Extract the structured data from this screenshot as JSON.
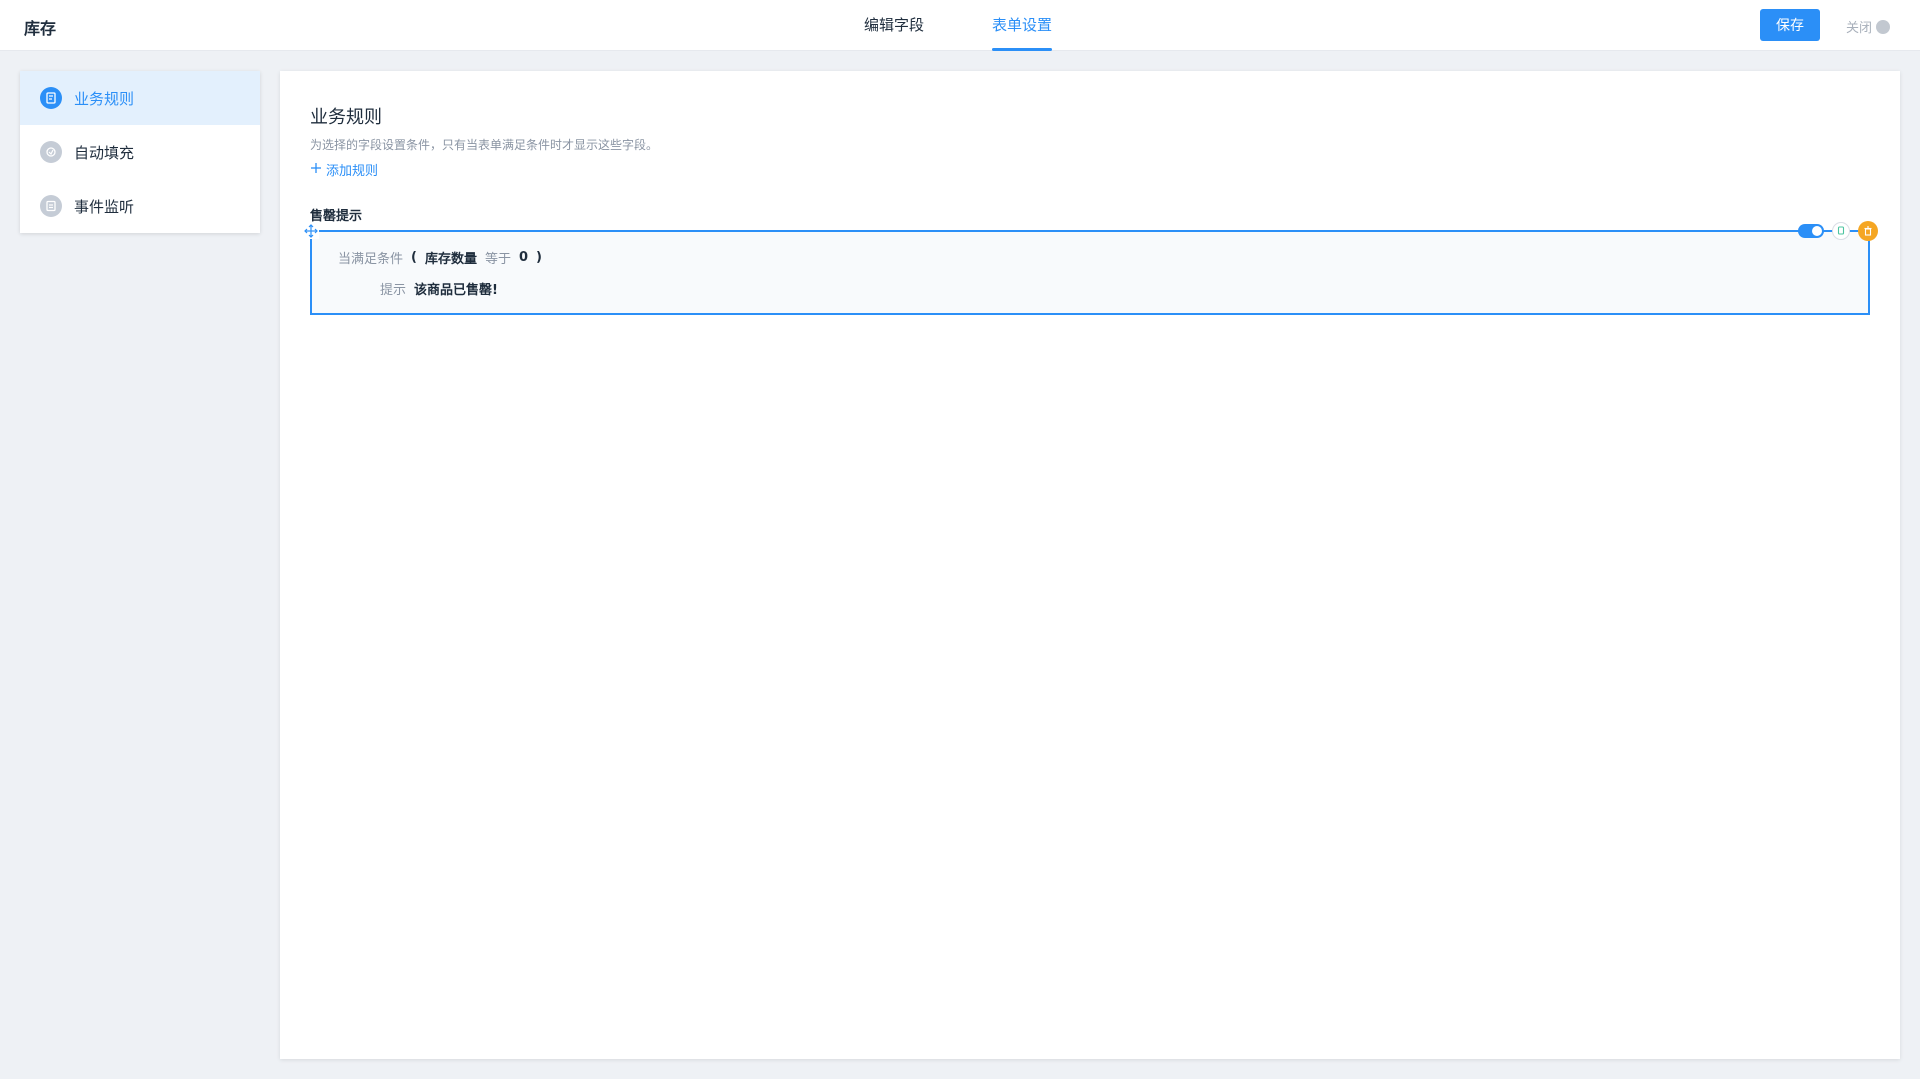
{
  "header": {
    "app_title": "库存",
    "tabs": [
      {
        "label": "编辑字段"
      },
      {
        "label": "表单设置"
      }
    ],
    "save_label": "保存",
    "close_label": "关闭"
  },
  "sidebar": {
    "items": [
      {
        "label": "业务规则",
        "icon": "rules-icon",
        "active": true
      },
      {
        "label": "自动填充",
        "icon": "autofill-icon",
        "active": false
      },
      {
        "label": "事件监听",
        "icon": "event-listener-icon",
        "active": false
      }
    ]
  },
  "main": {
    "title": "业务规则",
    "description": "为选择的字段设置条件，只有当表单满足条件时才显示这些字段。",
    "add_rule_label": "添加规则",
    "rules": [
      {
        "name": "售罄提示",
        "enabled": true,
        "condition_prefix": "当满足条件",
        "open_paren": "(",
        "field": "库存数量",
        "operator": "等于",
        "value": "0",
        "close_paren": ")",
        "tip_label": "提示",
        "tip_text": "该商品已售罄!"
      }
    ]
  },
  "colors": {
    "accent": "#2b8ff7",
    "active_nav_bg": "#e3f0fd",
    "delete": "#f5a623",
    "page_bg": "#eef1f5"
  }
}
